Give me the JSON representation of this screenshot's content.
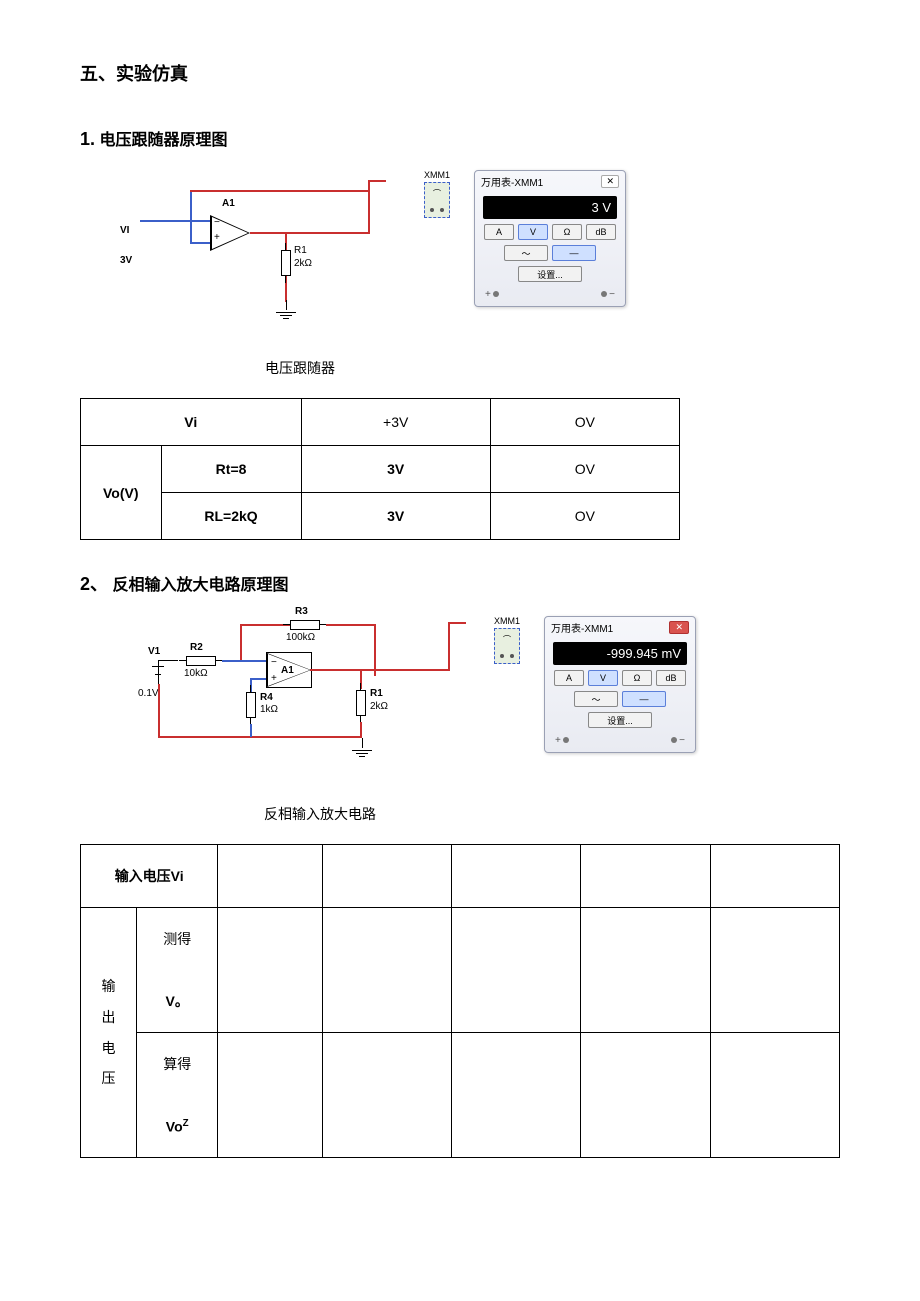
{
  "heading": "五、实验仿真",
  "section1": {
    "title_num": "1.",
    "title_text": "电压跟随器原理图",
    "caption": "电压跟随器",
    "labels": {
      "vi": "VI",
      "vi_val": "3V",
      "a1": "A1",
      "r1": "R1",
      "r1_val": "2kΩ",
      "xmm": "XMM1"
    },
    "meter": {
      "title": "万用表-XMM1",
      "close": "✕",
      "display": "3 V",
      "row1": {
        "a": "A",
        "v": "V",
        "ohm": "Ω",
        "db": "dB"
      },
      "row2": {
        "ac": "〜",
        "dc": "—"
      },
      "settings": "设置...",
      "plus": "+",
      "minus": "−"
    }
  },
  "table1": {
    "r1c1": "Vi",
    "r1c2": "+3V",
    "r1c3": "OV",
    "r2c0": "Vo(V)",
    "r2c1": "Rt=8",
    "r2c2": "3V",
    "r2c3": "OV",
    "r3c1": "RL=2kQ",
    "r3c2": "3V",
    "r3c3": "OV"
  },
  "section2": {
    "title_num": "2、",
    "title_text": "反相输入放大电路原理图",
    "caption": "反相输入放大电路",
    "labels": {
      "v1": "V1",
      "v1_val": "0.1V",
      "r2": "R2",
      "r2_val": "10kΩ",
      "r3": "R3",
      "r3_val": "100kΩ",
      "r4": "R4",
      "r4_val": "1kΩ",
      "r1": "R1",
      "r1_val": "2kΩ",
      "a1": "A1",
      "xmm": "XMM1"
    },
    "meter": {
      "title": "万用表-XMM1",
      "display": "-999.945 mV",
      "row1": {
        "a": "A",
        "v": "V",
        "ohm": "Ω",
        "db": "dB"
      },
      "row2": {
        "ac": "〜",
        "dc": "—"
      },
      "settings": "设置...",
      "plus": "+",
      "minus": "−"
    }
  },
  "table2": {
    "row1_label": "输入电压Vi",
    "row_vo_label": "输出电压",
    "row2_a": "测得",
    "row2_b": "V。",
    "row3_a": "算得",
    "row3_b": "Vo",
    "row3_b_sup": "Z"
  }
}
